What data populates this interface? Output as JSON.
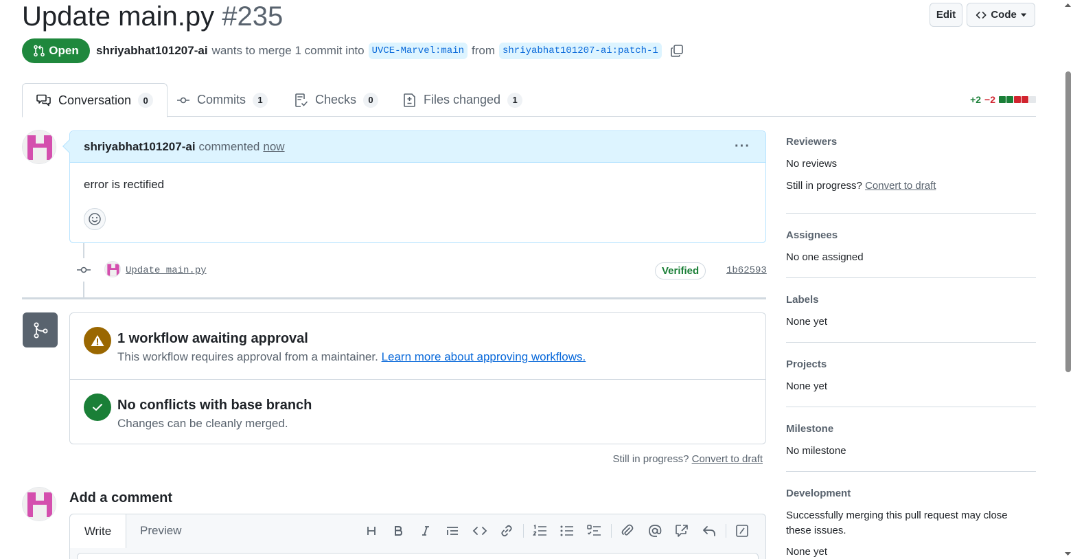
{
  "header": {
    "title": "Update main.py",
    "number": "#235",
    "edit_label": "Edit",
    "code_label": "Code"
  },
  "pr_state": {
    "label": "Open",
    "author": "shriyabhat101207-ai",
    "text": "wants to merge 1 commit into",
    "base_branch": "UVCE-Marvel:main",
    "from_text": "from",
    "head_branch": "shriyabhat101207-ai:patch-1"
  },
  "tabs": [
    {
      "label": "Conversation",
      "count": "0"
    },
    {
      "label": "Commits",
      "count": "1"
    },
    {
      "label": "Checks",
      "count": "0"
    },
    {
      "label": "Files changed",
      "count": "1"
    }
  ],
  "diffstat": {
    "additions": "+2",
    "deletions": "−2"
  },
  "comment": {
    "author": "shriyabhat101207-ai",
    "action": "commented",
    "time": "now",
    "body": "error is rectified"
  },
  "commit": {
    "message": "Update main.py",
    "verified": "Verified",
    "sha": "1b62593"
  },
  "merge": {
    "workflow_title": "1 workflow awaiting approval",
    "workflow_text": "This workflow requires approval from a maintainer.",
    "workflow_link": "Learn more about approving workflows.",
    "conflict_title": "No conflicts with base branch",
    "conflict_text": "Changes can be cleanly merged."
  },
  "draft": {
    "prompt": "Still in progress?",
    "link": "Convert to draft"
  },
  "add_comment": {
    "title": "Add a comment",
    "write_tab": "Write",
    "preview_tab": "Preview"
  },
  "sidebar": {
    "reviewers": {
      "heading": "Reviewers",
      "value": "No reviews",
      "prompt": "Still in progress?",
      "link": "Convert to draft"
    },
    "assignees": {
      "heading": "Assignees",
      "value": "No one assigned"
    },
    "labels": {
      "heading": "Labels",
      "value": "None yet"
    },
    "projects": {
      "heading": "Projects",
      "value": "None yet"
    },
    "milestone": {
      "heading": "Milestone",
      "value": "No milestone"
    },
    "development": {
      "heading": "Development",
      "value": "Successfully merging this pull request may close these issues.",
      "issues": "None yet"
    }
  },
  "colors": {
    "open_green": "#1f883d",
    "link_blue": "#0969da",
    "warning": "#9a6700",
    "success": "#1a7f37",
    "avatar_pink": "#d44fae"
  }
}
